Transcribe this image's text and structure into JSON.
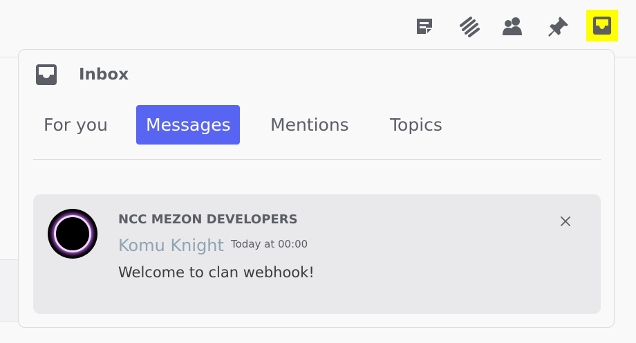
{
  "header_icons": [
    {
      "name": "threads-icon",
      "color": "#5c5e66"
    },
    {
      "name": "canvas-icon",
      "color": "#5c5e66"
    },
    {
      "name": "members-icon",
      "color": "#5c5e66"
    },
    {
      "name": "pin-icon",
      "color": "#5c5e66"
    },
    {
      "name": "inbox-icon",
      "color": "#5c5e66",
      "highlight": "#ffff00",
      "active": true
    }
  ],
  "inbox": {
    "title": "Inbox",
    "icon": "inbox-icon",
    "tabs": [
      {
        "label": "For you",
        "selected": false
      },
      {
        "label": "Messages",
        "selected": true
      },
      {
        "label": "Mentions",
        "selected": false
      },
      {
        "label": "Topics",
        "selected": false
      }
    ],
    "accent": "#5865f2",
    "notification": {
      "clan_name": "NCC MEZON DEVELOPERS",
      "sender": "Komu Knight",
      "timestamp": "Today at 00:00",
      "message": "Welcome to clan webhook!",
      "close_icon": "close-icon"
    }
  }
}
